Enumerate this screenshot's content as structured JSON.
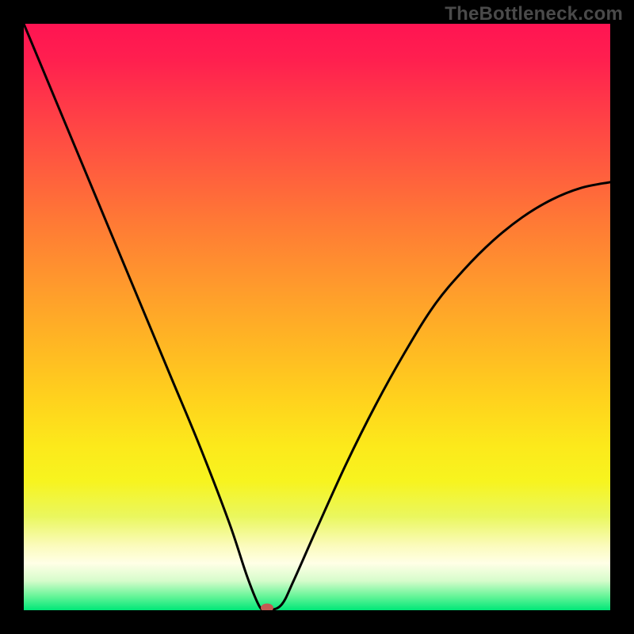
{
  "watermark": "TheBottleneck.com",
  "chart_data": {
    "type": "line",
    "title": "",
    "xlabel": "",
    "ylabel": "",
    "xlim": [
      0,
      100
    ],
    "ylim": [
      0,
      100
    ],
    "grid": false,
    "legend": false,
    "series": [
      {
        "name": "curve",
        "x": [
          0,
          5,
          10,
          15,
          20,
          25,
          30,
          35,
          38,
          40,
          41,
          42,
          44,
          46,
          50,
          55,
          60,
          65,
          70,
          75,
          80,
          85,
          90,
          95,
          100
        ],
        "values": [
          100,
          88,
          76,
          64,
          52,
          40,
          28,
          15,
          6,
          1,
          0,
          0,
          1,
          5,
          14,
          25,
          35,
          44,
          52,
          58,
          63,
          67,
          70,
          72,
          73
        ]
      }
    ],
    "marker": {
      "x": 41.5,
      "y": 0
    },
    "background_gradient_stops": [
      {
        "pct": 0,
        "color": "#ff1452"
      },
      {
        "pct": 50,
        "color": "#ffb524"
      },
      {
        "pct": 90,
        "color": "#fbfbbc"
      },
      {
        "pct": 100,
        "color": "#00e778"
      }
    ]
  }
}
